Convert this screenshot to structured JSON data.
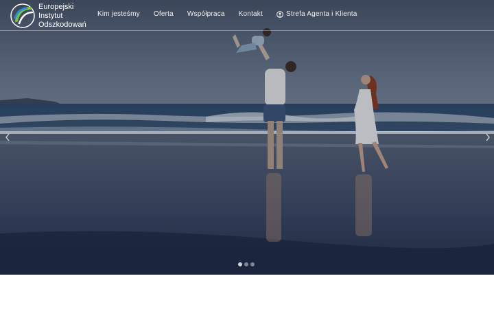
{
  "brand": {
    "line1": "Europejski",
    "line2": "Instytut",
    "line3": "Odszkodowań"
  },
  "nav": {
    "items": [
      {
        "label": "Kim jesteśmy"
      },
      {
        "label": "Oferta"
      },
      {
        "label": "Współpraca"
      },
      {
        "label": "Kontakt"
      }
    ],
    "account_label": "Strefa Agenta i Klienta",
    "account_icon": "user-circle-icon"
  },
  "slider": {
    "slides": 3,
    "active_slide": 1,
    "prev_icon": "chevron-left-icon",
    "next_icon": "chevron-right-icon"
  },
  "colors": {
    "logo_green": "#7cc142",
    "logo_blue": "#2a8fd1",
    "sky": "#5f6f86",
    "sea": "#2b3f5c",
    "sand_wet": "#46546c"
  }
}
